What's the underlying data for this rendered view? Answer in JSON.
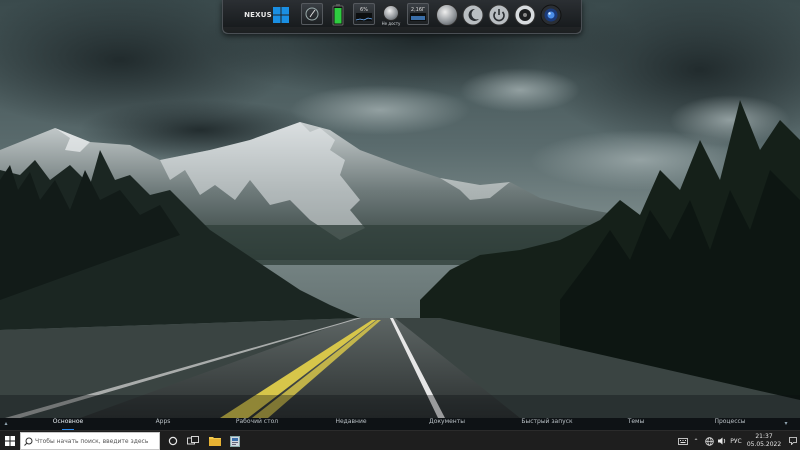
{
  "dock": {
    "logo_text": "NEXUS",
    "tiles": [
      {
        "name": "clock-widget-tile",
        "label": ""
      },
      {
        "name": "battery-widget-tile",
        "label": ""
      },
      {
        "name": "cpu-meter-tile",
        "label": "6%"
      },
      {
        "name": "disk-info-tile",
        "label": "Не досту"
      },
      {
        "name": "ram-meter-tile",
        "label": "2,16Г"
      }
    ]
  },
  "tabs": [
    {
      "label": "Основное",
      "active": true
    },
    {
      "label": "Apps",
      "active": false
    },
    {
      "label": "Рабочий стол",
      "active": false
    },
    {
      "label": "Недавние",
      "active": false
    },
    {
      "label": "Документы",
      "active": false
    },
    {
      "label": "Быстрый запуск",
      "active": false
    },
    {
      "label": "Темы",
      "active": false
    },
    {
      "label": "Процессы",
      "active": false
    }
  ],
  "taskbar": {
    "search_placeholder": "Чтобы начать поиск, введите здесь",
    "tray_language": "РУС",
    "clock_time": "21:37",
    "clock_date": "05.05.2022"
  },
  "colors": {
    "accent_blue": "#2d8cf0",
    "windows_blue": "#1a8fe3",
    "battery_green": "#2ecc40"
  }
}
